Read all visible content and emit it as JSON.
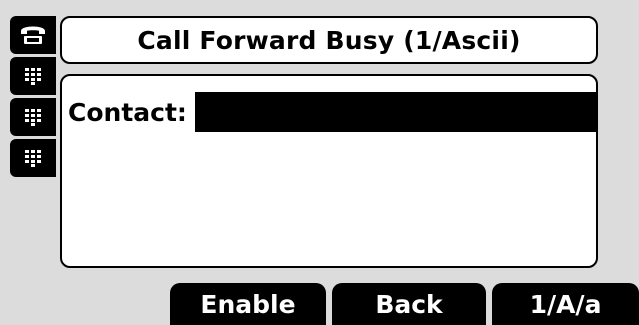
{
  "line_keys": [
    {
      "icon": "handset-icon"
    },
    {
      "icon": "keypad-icon"
    },
    {
      "icon": "keypad-icon"
    },
    {
      "icon": "keypad-icon"
    }
  ],
  "title": "Call Forward Busy (1/Ascii)",
  "contact": {
    "label": "Contact:",
    "value": ""
  },
  "softkeys": [
    {
      "label": "Enable"
    },
    {
      "label": "Back"
    },
    {
      "label": "1/A/a"
    }
  ]
}
